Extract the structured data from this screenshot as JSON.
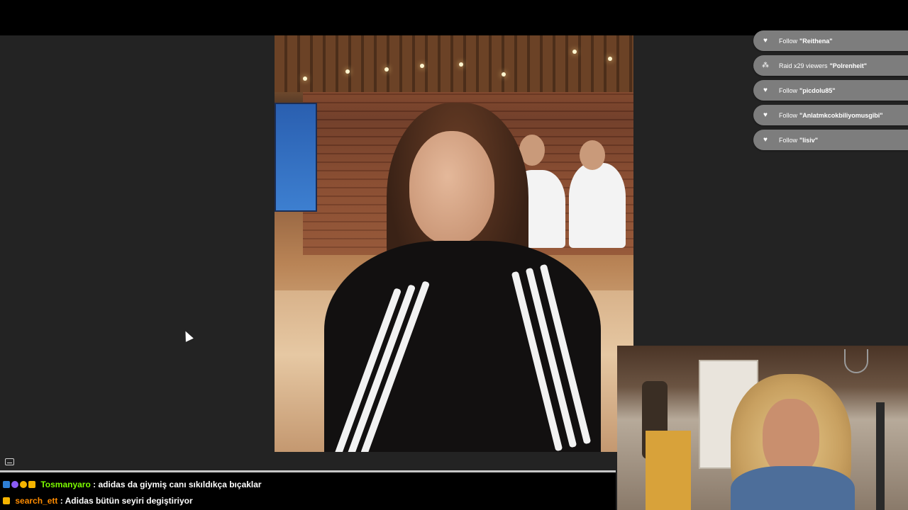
{
  "alerts": [
    {
      "type": "Follow",
      "name": "\"Reithena\"",
      "icon": "heart-icon"
    },
    {
      "type": "Raid x29 viewers",
      "name": "\"Polrenheit\"",
      "icon": "raid-icon"
    },
    {
      "type": "Follow",
      "name": "\"picdolu85\"",
      "icon": "heart-icon"
    },
    {
      "type": "Follow",
      "name": "\"Anlatmkcokbiliyomusgibi\"",
      "icon": "heart-icon"
    },
    {
      "type": "Follow",
      "name": "\"lisiv\"",
      "icon": "heart-icon"
    }
  ],
  "chat": {
    "messages": [
      {
        "user": "Tosmanyaro",
        "user_color": "#7CFC00",
        "text": " : adidas da giymiş canı sıkıldıkça bıçaklar"
      },
      {
        "user": "search_ett",
        "user_color": "#FF8C00",
        "text": " : Adidas bütün seyiri degiştiriyor"
      }
    ]
  },
  "colors": {
    "background": "#232323",
    "alert_bg": "#7d7d7d",
    "chat_bg": "#000000"
  }
}
